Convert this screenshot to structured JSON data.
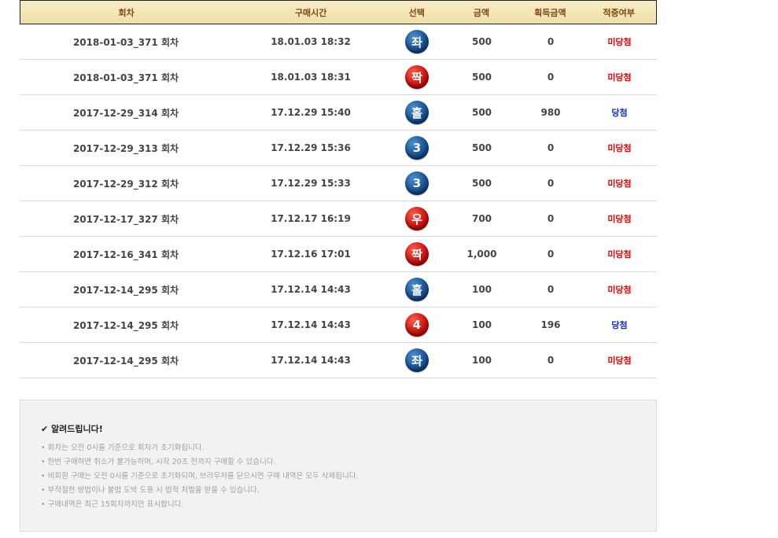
{
  "headers": [
    "회차",
    "구매시간",
    "선택",
    "금액",
    "획득금액",
    "적중여부"
  ],
  "rows": [
    {
      "round": "2018-01-03_371 회차",
      "time": "18.01.03 18:32",
      "pick": "좌",
      "pick_color": "blue",
      "amount": "500",
      "won": "0",
      "result": "미당첨",
      "status": "lose"
    },
    {
      "round": "2018-01-03_371 회차",
      "time": "18.01.03 18:31",
      "pick": "짝",
      "pick_color": "red",
      "amount": "500",
      "won": "0",
      "result": "미당첨",
      "status": "lose"
    },
    {
      "round": "2017-12-29_314 회차",
      "time": "17.12.29 15:40",
      "pick": "홀",
      "pick_color": "blue",
      "amount": "500",
      "won": "980",
      "result": "당첨",
      "status": "win"
    },
    {
      "round": "2017-12-29_313 회차",
      "time": "17.12.29 15:36",
      "pick": "3",
      "pick_color": "blue",
      "amount": "500",
      "won": "0",
      "result": "미당첨",
      "status": "lose"
    },
    {
      "round": "2017-12-29_312 회차",
      "time": "17.12.29 15:33",
      "pick": "3",
      "pick_color": "blue",
      "amount": "500",
      "won": "0",
      "result": "미당첨",
      "status": "lose"
    },
    {
      "round": "2017-12-17_327 회차",
      "time": "17.12.17 16:19",
      "pick": "우",
      "pick_color": "red",
      "amount": "700",
      "won": "0",
      "result": "미당첨",
      "status": "lose"
    },
    {
      "round": "2017-12-16_341 회차",
      "time": "17.12.16 17:01",
      "pick": "짝",
      "pick_color": "red",
      "amount": "1,000",
      "won": "0",
      "result": "미당첨",
      "status": "lose"
    },
    {
      "round": "2017-12-14_295 회차",
      "time": "17.12.14 14:43",
      "pick": "홀",
      "pick_color": "blue",
      "amount": "100",
      "won": "0",
      "result": "미당첨",
      "status": "lose"
    },
    {
      "round": "2017-12-14_295 회차",
      "time": "17.12.14 14:43",
      "pick": "4",
      "pick_color": "red",
      "amount": "100",
      "won": "196",
      "result": "당첨",
      "status": "win"
    },
    {
      "round": "2017-12-14_295 회차",
      "time": "17.12.14 14:43",
      "pick": "좌",
      "pick_color": "blue",
      "amount": "100",
      "won": "0",
      "result": "미당첨",
      "status": "lose"
    }
  ],
  "notice": {
    "title": "✔ 알려드립니다!",
    "lines": [
      "• 회차는 오전 0시를 기준으로 회차가 초기화됩니다.",
      "• 한번 구매하면 취소가 불가능하며, 시작 20초 전까지 구매할 수 있습니다.",
      "• 비회원 구매는 오전 0시를 기준으로 초기화되며, 브라우저를 닫으시면 구매 내역은 모두 삭제됩니다.",
      "• 부적절한 방법이나 불법 도박 도용 시 법적 처벌을 받을 수 있습니다.",
      "• 구매내역은 최근 15회차까지만 표시합니다."
    ]
  },
  "colors": {
    "win": "#1030c0",
    "lose": "#e00000",
    "header_text": "#7a4a12"
  }
}
